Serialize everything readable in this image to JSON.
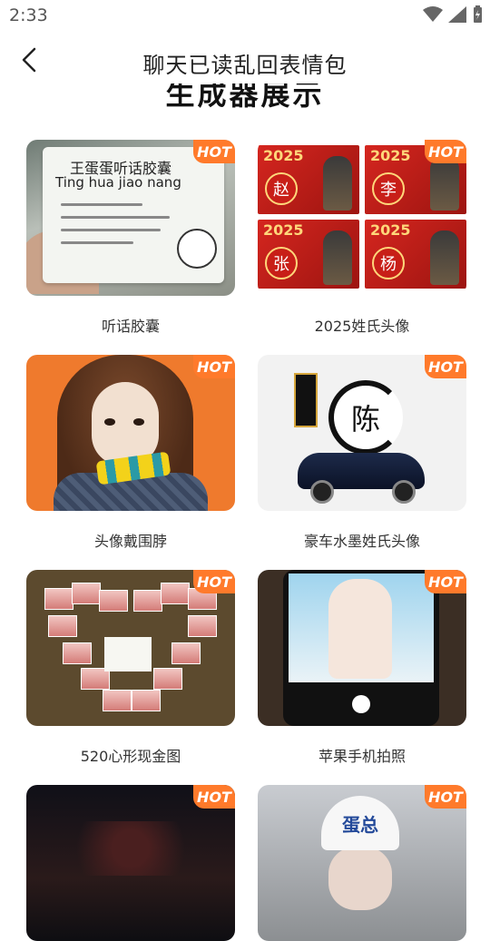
{
  "status_bar": {
    "time": "2:33"
  },
  "header": {
    "title": "聊天已读乱回表情包"
  },
  "section": {
    "title": "生成器展示"
  },
  "badge_text": "HOT",
  "accent_color": "#ff7a2b",
  "cards": [
    {
      "label": "听话胶囊",
      "thumb": {
        "line1": "王蛋蛋听话胶囊",
        "line2": "Ting hua jiao nang"
      }
    },
    {
      "label": "2025姓氏头像",
      "thumb": {
        "year": "2025",
        "names": [
          "赵",
          "李",
          "张",
          "杨"
        ]
      }
    },
    {
      "label": "头像戴围脖"
    },
    {
      "label": "豪车水墨姓氏头像",
      "thumb": {
        "char": "陈"
      }
    },
    {
      "label": "520心形现金图"
    },
    {
      "label": "苹果手机拍照"
    },
    {
      "label": "",
      "thumb": {}
    },
    {
      "label": "",
      "thumb": {
        "helmet": "蛋总"
      }
    }
  ]
}
